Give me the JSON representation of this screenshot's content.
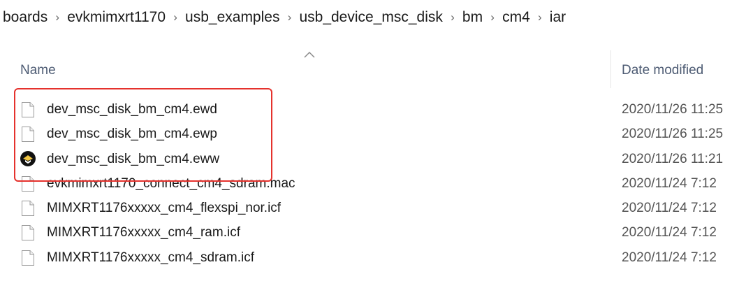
{
  "breadcrumb": [
    "boards",
    "evkmimxrt1170",
    "usb_examples",
    "usb_device_msc_disk",
    "bm",
    "cm4",
    "iar"
  ],
  "columns": {
    "name": "Name",
    "date": "Date modified"
  },
  "sort": {
    "column": "Name",
    "direction": "ascending"
  },
  "files": [
    {
      "name": "dev_msc_disk_bm_cm4.ewd",
      "date": "2020/11/26 11:25",
      "icon": "blank-file-icon"
    },
    {
      "name": "dev_msc_disk_bm_cm4.ewp",
      "date": "2020/11/26 11:25",
      "icon": "blank-file-icon"
    },
    {
      "name": "dev_msc_disk_bm_cm4.eww",
      "date": "2020/11/26 11:21",
      "icon": "iar-workspace-icon"
    },
    {
      "name": "evkmimxrt1170_connect_cm4_sdram.mac",
      "date": "2020/11/24 7:12",
      "icon": "blank-file-icon"
    },
    {
      "name": "MIMXRT1176xxxxx_cm4_flexspi_nor.icf",
      "date": "2020/11/24 7:12",
      "icon": "blank-file-icon"
    },
    {
      "name": "MIMXRT1176xxxxx_cm4_ram.icf",
      "date": "2020/11/24 7:12",
      "icon": "blank-file-icon"
    },
    {
      "name": "MIMXRT1176xxxxx_cm4_sdram.icf",
      "date": "2020/11/24 7:12",
      "icon": "blank-file-icon"
    }
  ],
  "colors": {
    "highlight": "#e5322d",
    "header_text": "#4d5b73",
    "date_text": "#545454"
  }
}
